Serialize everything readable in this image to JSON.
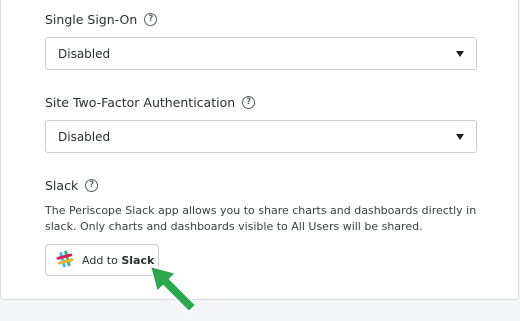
{
  "sso": {
    "label": "Single Sign-On",
    "value": "Disabled"
  },
  "two_factor": {
    "label": "Site Two-Factor Authentication",
    "value": "Disabled"
  },
  "slack": {
    "label": "Slack",
    "description": "The Periscope Slack app allows you to share charts and dashboards directly in slack. Only charts and dashboards visible to All Users will be shared.",
    "button_prefix": "Add to",
    "button_brand": "Slack"
  },
  "icons": {
    "help": "help-circle-icon",
    "dropdown": "caret-down-icon",
    "slack_logo": "slack-logo-icon",
    "pointer": "pointer-arrow-icon"
  },
  "colors": {
    "pointer_arrow": "#2aa84a"
  }
}
